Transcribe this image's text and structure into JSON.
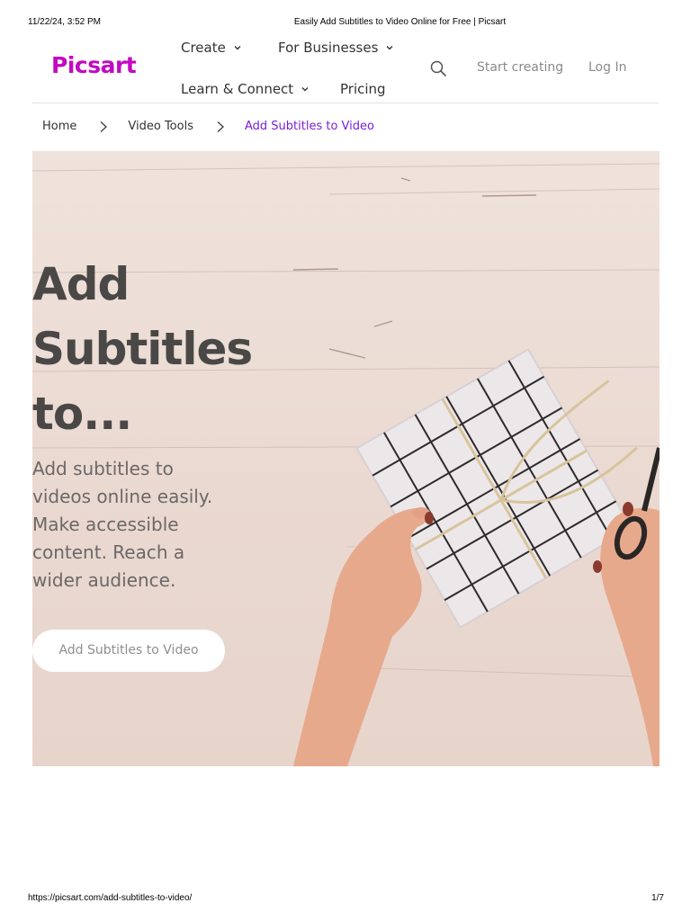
{
  "print": {
    "datetime": "11/22/24, 3:52 PM",
    "doc_title": "Easily Add Subtitles to Video Online for Free | Picsart",
    "url": "https://picsart.com/add-subtitles-to-video/",
    "page": "1/7"
  },
  "nav": {
    "logo": "Picsart",
    "logo_color": "#c209c1",
    "items": [
      {
        "label": "Create",
        "has_dropdown": true
      },
      {
        "label": "For Businesses",
        "has_dropdown": true
      },
      {
        "label": "Learn & Connect",
        "has_dropdown": true
      },
      {
        "label": "Pricing",
        "has_dropdown": false
      }
    ],
    "search_icon": "search-icon",
    "start_creating": "Start creating",
    "login": "Log In"
  },
  "breadcrumb": {
    "items": [
      "Home",
      "Video Tools",
      "Add Subtitles to Video"
    ],
    "current_color": "#7a1fd6"
  },
  "hero": {
    "title_lines": [
      "Add",
      "Subtitles",
      "to..."
    ],
    "description_lines": [
      "Add subtitles to",
      "videos online easily.",
      "Make accessible",
      "content. Reach a",
      "wider audience."
    ],
    "cta": "Add Subtitles to Video"
  }
}
